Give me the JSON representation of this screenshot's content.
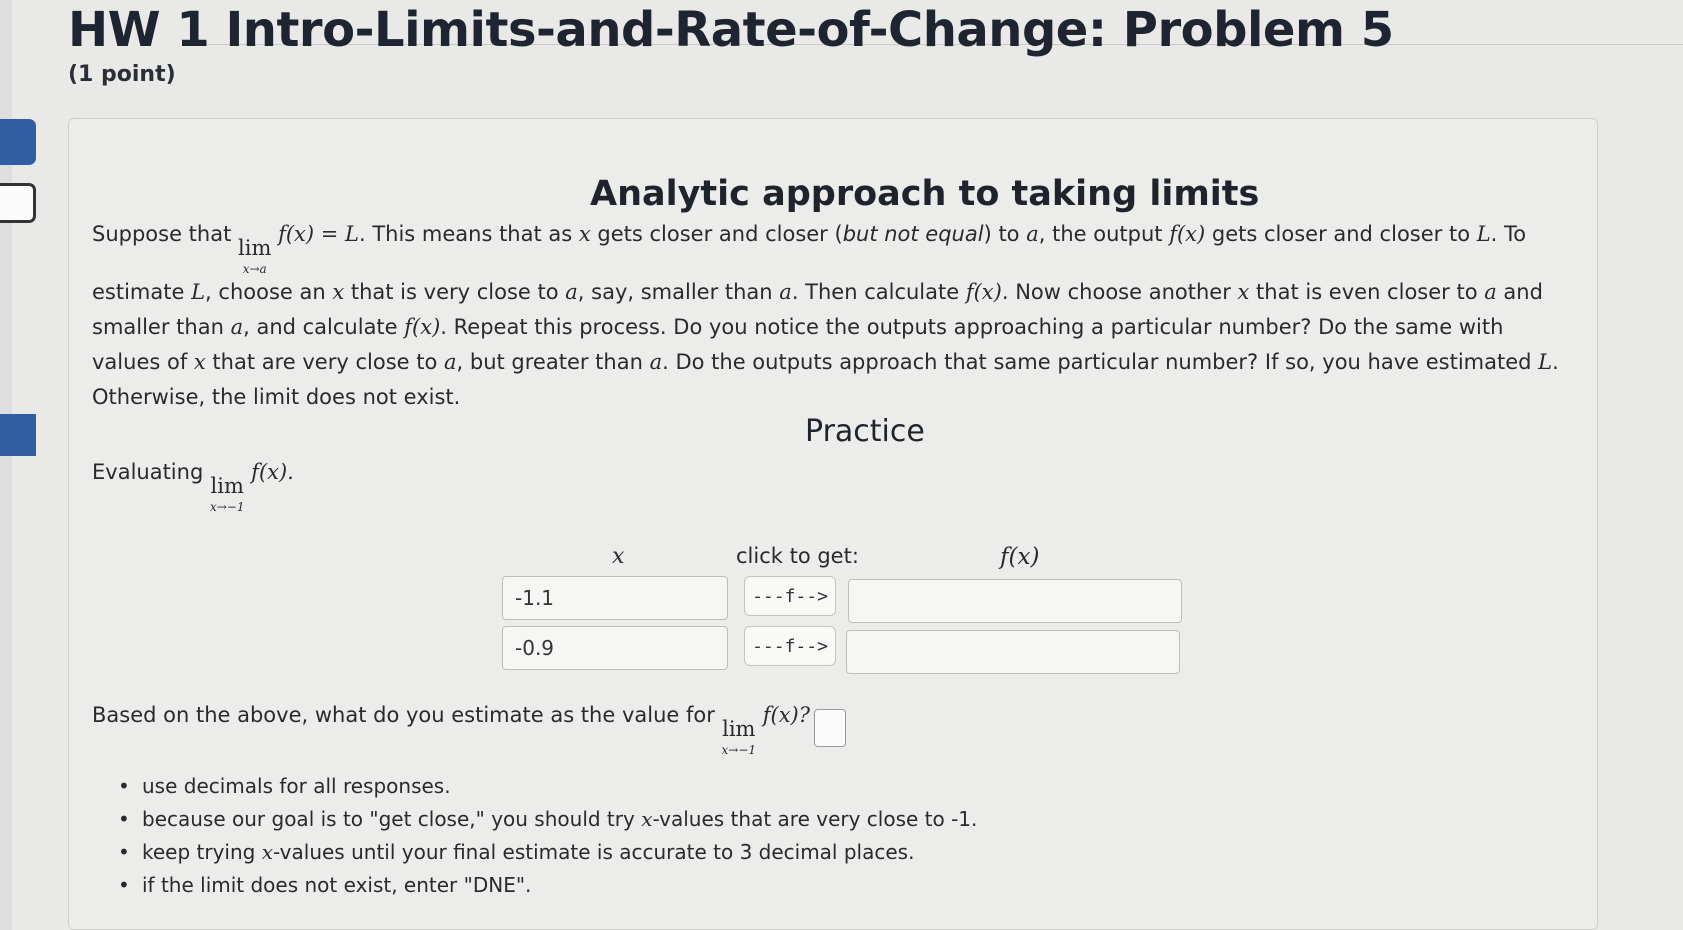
{
  "header": {
    "title": "HW 1 Intro-Limits-and-Rate-of-Change: Problem 5",
    "points": "(1 point)"
  },
  "problem": {
    "heading": "Analytic approach to taking limits",
    "paragraph": {
      "p1": "Suppose that ",
      "p2": ". This means that as ",
      "p3": " gets closer and closer (",
      "italic_phrase": "but not equal",
      "p4": ") to ",
      "p5": ", the output ",
      "p6": " gets closer and closer to ",
      "p7": ". To estimate ",
      "p8": ", choose an ",
      "p9": " that is very close to ",
      "p10": ", say, smaller than ",
      "p11": ". Then calculate ",
      "p12": ". Now choose another ",
      "p13": " that is even closer to ",
      "p14": " and smaller than ",
      "p15": ", and calculate ",
      "p16": ". Repeat this process. Do you notice the outputs approaching a particular number? Do the same with values of ",
      "p17": " that are very close to ",
      "p18": ", but greater than ",
      "p19": ". Do the outputs approach that same particular number? If so, you have estimated ",
      "p20": ". Otherwise, the limit does not exist.",
      "lim_text": "lim",
      "lim_sub": "x→a",
      "eq_rhs": "f(x) = L",
      "sym_x": "x",
      "sym_a": "a",
      "sym_fx": "f(x)",
      "sym_L": "L"
    },
    "practice_label": "Practice",
    "evaluating": {
      "prefix": "Evaluating ",
      "lim_text": "lim",
      "lim_sub": "x→−1",
      "expr": "f(x)."
    },
    "table": {
      "x_header": "x",
      "click_header": "click to get:",
      "fx_header": "f(x)",
      "rows": [
        {
          "x_value": "-1.1",
          "button_label": "---f-->",
          "fx_value": ""
        },
        {
          "x_value": "-0.9",
          "button_label": "---f-->",
          "fx_value": ""
        }
      ]
    },
    "question": {
      "text": "Based on the above, what do you estimate as the value for ",
      "lim_text": "lim",
      "lim_sub": "x→−1",
      "expr": "f(x)?",
      "answer_value": ""
    },
    "notes": {
      "n1": "use decimals for all responses.",
      "n2a": "because our goal is to \"get close,\" you should try ",
      "n2b": "-values that are very close to -1.",
      "n3a": "keep trying ",
      "n3b": "-values until your final estimate is accurate to 3 decimal places.",
      "n4": "if the limit does not exist, enter \"DNE\".",
      "sym_x": "x"
    }
  },
  "colors": {
    "page_bg": "#e9e9e7",
    "panel_bg": "#ececea",
    "accent_blue": "#2f5ea3",
    "text": "#2a2a2c"
  }
}
